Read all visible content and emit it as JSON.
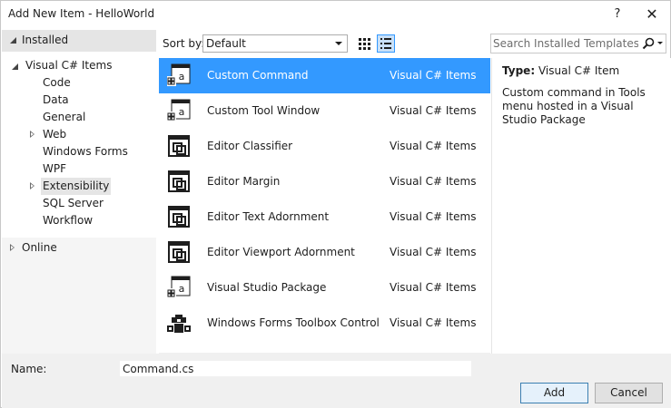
{
  "window": {
    "title": "Add New Item - HelloWorld",
    "help_label": "?",
    "close_label": "✕"
  },
  "sidebar": {
    "installed_label": "Installed",
    "root_label": "Visual C# Items",
    "items": [
      {
        "label": "Code"
      },
      {
        "label": "Data"
      },
      {
        "label": "General"
      },
      {
        "label": "Web"
      },
      {
        "label": "Windows Forms"
      },
      {
        "label": "WPF"
      },
      {
        "label": "Extensibility"
      },
      {
        "label": "SQL Server"
      },
      {
        "label": "Workflow"
      }
    ],
    "online_label": "Online"
  },
  "toolbar": {
    "sort_label": "Sort by:",
    "sort_value": "Default",
    "search_placeholder": "Search Installed Templates"
  },
  "templates": [
    {
      "name": "Custom Command",
      "category": "Visual C# Items",
      "icon": "command-template-icon"
    },
    {
      "name": "Custom Tool Window",
      "category": "Visual C# Items",
      "icon": "tool-window-template-icon"
    },
    {
      "name": "Editor Classifier",
      "category": "Visual C# Items",
      "icon": "editor-extension-icon"
    },
    {
      "name": "Editor Margin",
      "category": "Visual C# Items",
      "icon": "editor-extension-icon"
    },
    {
      "name": "Editor Text Adornment",
      "category": "Visual C# Items",
      "icon": "editor-extension-icon"
    },
    {
      "name": "Editor Viewport Adornment",
      "category": "Visual C# Items",
      "icon": "editor-extension-icon"
    },
    {
      "name": "Visual Studio Package",
      "category": "Visual C# Items",
      "icon": "package-template-icon"
    },
    {
      "name": "Windows Forms Toolbox Control",
      "category": "Visual C# Items",
      "icon": "toolbox-control-icon"
    }
  ],
  "details": {
    "type_label": "Type:",
    "type_value": "Visual C# Item",
    "description": "Custom command in Tools menu hosted in a Visual Studio Package"
  },
  "footer": {
    "name_label": "Name:",
    "name_value": "Command.cs",
    "add_label": "Add",
    "cancel_label": "Cancel"
  },
  "colors": {
    "selection": "#3399ff",
    "tree_selection": "#e5e5e5",
    "footer_bg": "#f0f0f0"
  }
}
